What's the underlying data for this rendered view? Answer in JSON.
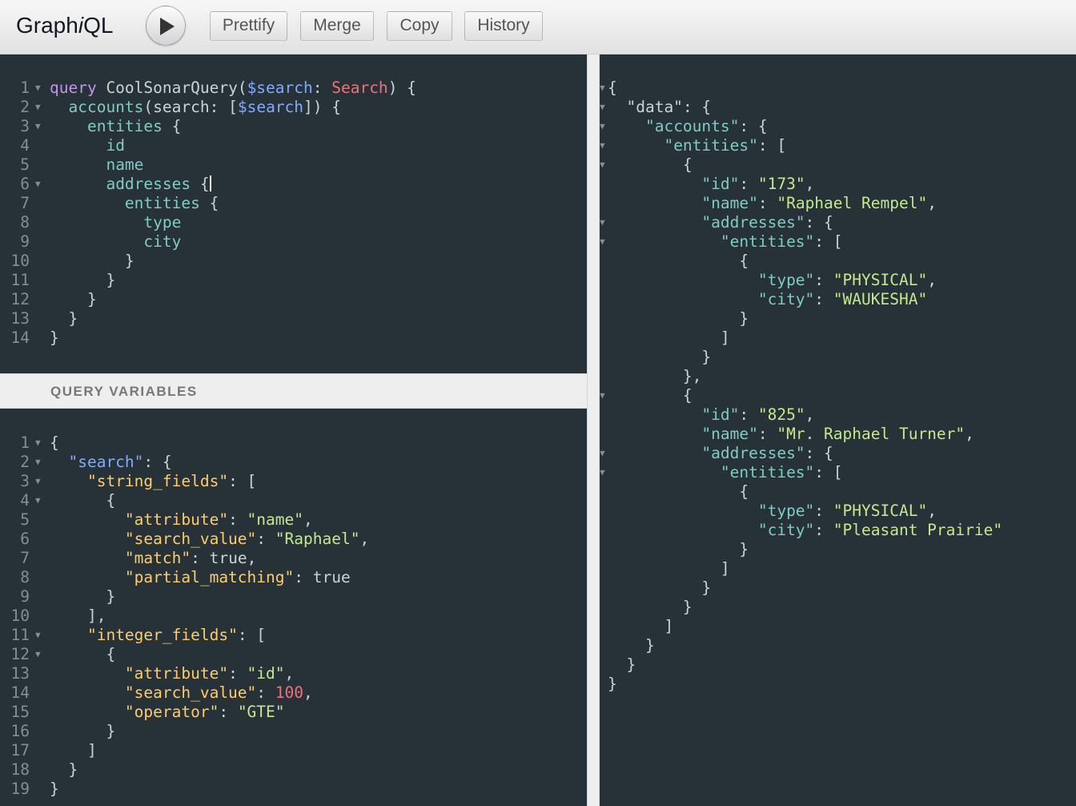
{
  "app": {
    "title_prefix": "Graph",
    "title_italic": "i",
    "title_suffix": "QL"
  },
  "toolbar": {
    "prettify": "Prettify",
    "merge": "Merge",
    "copy": "Copy",
    "history": "History"
  },
  "variables": {
    "header": "QUERY VARIABLES"
  },
  "query_editor": {
    "lines": [
      [
        [
          "kw",
          "query"
        ],
        [
          "def",
          " CoolSonarQuery"
        ],
        [
          "punc",
          "("
        ],
        [
          "var",
          "$search"
        ],
        [
          "punc",
          ": "
        ],
        [
          "type",
          "Search"
        ],
        [
          "punc",
          ") {"
        ]
      ],
      [
        [
          "def",
          "  "
        ],
        [
          "field",
          "accounts"
        ],
        [
          "punc",
          "("
        ],
        [
          "def",
          "search"
        ],
        [
          "punc",
          ": ["
        ],
        [
          "var",
          "$search"
        ],
        [
          "punc",
          "]) {"
        ]
      ],
      [
        [
          "def",
          "    "
        ],
        [
          "field",
          "entities"
        ],
        [
          "punc",
          " {"
        ]
      ],
      [
        [
          "def",
          "      "
        ],
        [
          "field",
          "id"
        ]
      ],
      [
        [
          "def",
          "      "
        ],
        [
          "field",
          "name"
        ]
      ],
      [
        [
          "def",
          "      "
        ],
        [
          "field",
          "addresses"
        ],
        [
          "punc",
          " {"
        ],
        [
          "cursor",
          ""
        ]
      ],
      [
        [
          "def",
          "        "
        ],
        [
          "field",
          "entities"
        ],
        [
          "punc",
          " {"
        ]
      ],
      [
        [
          "def",
          "          "
        ],
        [
          "field",
          "type"
        ]
      ],
      [
        [
          "def",
          "          "
        ],
        [
          "field",
          "city"
        ]
      ],
      [
        [
          "punc",
          "        }"
        ]
      ],
      [
        [
          "punc",
          "      }"
        ]
      ],
      [
        [
          "punc",
          "    }"
        ]
      ],
      [
        [
          "punc",
          "  }"
        ]
      ],
      [
        [
          "punc",
          "}"
        ]
      ]
    ],
    "folds": [
      1,
      2,
      3,
      6
    ]
  },
  "variables_editor": {
    "lines": [
      [
        [
          "punc",
          "{"
        ]
      ],
      [
        [
          "def",
          "  "
        ],
        [
          "vkey",
          "\"search\""
        ],
        [
          "punc",
          ": {"
        ]
      ],
      [
        [
          "def",
          "    "
        ],
        [
          "vkey2",
          "\"string_fields\""
        ],
        [
          "punc",
          ": ["
        ]
      ],
      [
        [
          "punc",
          "      {"
        ]
      ],
      [
        [
          "def",
          "        "
        ],
        [
          "vkey2",
          "\"attribute\""
        ],
        [
          "punc",
          ": "
        ],
        [
          "str",
          "\"name\""
        ],
        [
          "punc",
          ","
        ]
      ],
      [
        [
          "def",
          "        "
        ],
        [
          "vkey2",
          "\"search_value\""
        ],
        [
          "punc",
          ": "
        ],
        [
          "str",
          "\"Raphael\""
        ],
        [
          "punc",
          ","
        ]
      ],
      [
        [
          "def",
          "        "
        ],
        [
          "vkey2",
          "\"match\""
        ],
        [
          "punc",
          ": "
        ],
        [
          "bool",
          "true"
        ],
        [
          "punc",
          ","
        ]
      ],
      [
        [
          "def",
          "        "
        ],
        [
          "vkey2",
          "\"partial_matching\""
        ],
        [
          "punc",
          ": "
        ],
        [
          "bool",
          "true"
        ]
      ],
      [
        [
          "punc",
          "      }"
        ]
      ],
      [
        [
          "punc",
          "    ],"
        ]
      ],
      [
        [
          "def",
          "    "
        ],
        [
          "vkey2",
          "\"integer_fields\""
        ],
        [
          "punc",
          ": ["
        ]
      ],
      [
        [
          "punc",
          "      {"
        ]
      ],
      [
        [
          "def",
          "        "
        ],
        [
          "vkey2",
          "\"attribute\""
        ],
        [
          "punc",
          ": "
        ],
        [
          "str",
          "\"id\""
        ],
        [
          "punc",
          ","
        ]
      ],
      [
        [
          "def",
          "        "
        ],
        [
          "vkey2",
          "\"search_value\""
        ],
        [
          "punc",
          ": "
        ],
        [
          "num",
          "100"
        ],
        [
          "punc",
          ","
        ]
      ],
      [
        [
          "def",
          "        "
        ],
        [
          "vkey2",
          "\"operator\""
        ],
        [
          "punc",
          ": "
        ],
        [
          "str",
          "\"GTE\""
        ]
      ],
      [
        [
          "punc",
          "      }"
        ]
      ],
      [
        [
          "punc",
          "    ]"
        ]
      ],
      [
        [
          "punc",
          "  }"
        ]
      ],
      [
        [
          "punc",
          "}"
        ]
      ]
    ],
    "folds": [
      1,
      2,
      3,
      4,
      11,
      12
    ]
  },
  "result_viewer": {
    "lines": [
      [
        [
          "punc",
          "{"
        ]
      ],
      [
        [
          "def",
          "  "
        ],
        [
          "def",
          "\"data\""
        ],
        [
          "punc",
          ": {"
        ]
      ],
      [
        [
          "def",
          "    "
        ],
        [
          "rkey",
          "\"accounts\""
        ],
        [
          "punc",
          ": {"
        ]
      ],
      [
        [
          "def",
          "      "
        ],
        [
          "rkey",
          "\"entities\""
        ],
        [
          "punc",
          ": ["
        ]
      ],
      [
        [
          "punc",
          "        {"
        ]
      ],
      [
        [
          "def",
          "          "
        ],
        [
          "rkey",
          "\"id\""
        ],
        [
          "punc",
          ": "
        ],
        [
          "rstr",
          "\"173\""
        ],
        [
          "punc",
          ","
        ]
      ],
      [
        [
          "def",
          "          "
        ],
        [
          "rkey",
          "\"name\""
        ],
        [
          "punc",
          ": "
        ],
        [
          "rstr",
          "\"Raphael Rempel\""
        ],
        [
          "punc",
          ","
        ]
      ],
      [
        [
          "def",
          "          "
        ],
        [
          "rkey",
          "\"addresses\""
        ],
        [
          "punc",
          ": {"
        ]
      ],
      [
        [
          "def",
          "            "
        ],
        [
          "rkey",
          "\"entities\""
        ],
        [
          "punc",
          ": ["
        ]
      ],
      [
        [
          "punc",
          "              {"
        ]
      ],
      [
        [
          "def",
          "                "
        ],
        [
          "rkey",
          "\"type\""
        ],
        [
          "punc",
          ": "
        ],
        [
          "rstr",
          "\"PHYSICAL\""
        ],
        [
          "punc",
          ","
        ]
      ],
      [
        [
          "def",
          "                "
        ],
        [
          "rkey",
          "\"city\""
        ],
        [
          "punc",
          ": "
        ],
        [
          "rstr",
          "\"WAUKESHA\""
        ]
      ],
      [
        [
          "punc",
          "              }"
        ]
      ],
      [
        [
          "punc",
          "            ]"
        ]
      ],
      [
        [
          "punc",
          "          }"
        ]
      ],
      [
        [
          "punc",
          "        },"
        ]
      ],
      [
        [
          "punc",
          "        {"
        ]
      ],
      [
        [
          "def",
          "          "
        ],
        [
          "rkey",
          "\"id\""
        ],
        [
          "punc",
          ": "
        ],
        [
          "rstr",
          "\"825\""
        ],
        [
          "punc",
          ","
        ]
      ],
      [
        [
          "def",
          "          "
        ],
        [
          "rkey",
          "\"name\""
        ],
        [
          "punc",
          ": "
        ],
        [
          "rstr",
          "\"Mr. Raphael Turner\""
        ],
        [
          "punc",
          ","
        ]
      ],
      [
        [
          "def",
          "          "
        ],
        [
          "rkey",
          "\"addresses\""
        ],
        [
          "punc",
          ": {"
        ]
      ],
      [
        [
          "def",
          "            "
        ],
        [
          "rkey",
          "\"entities\""
        ],
        [
          "punc",
          ": ["
        ]
      ],
      [
        [
          "punc",
          "              {"
        ]
      ],
      [
        [
          "def",
          "                "
        ],
        [
          "rkey",
          "\"type\""
        ],
        [
          "punc",
          ": "
        ],
        [
          "rstr",
          "\"PHYSICAL\""
        ],
        [
          "punc",
          ","
        ]
      ],
      [
        [
          "def",
          "                "
        ],
        [
          "rkey",
          "\"city\""
        ],
        [
          "punc",
          ": "
        ],
        [
          "rstr",
          "\"Pleasant Prairie\""
        ]
      ],
      [
        [
          "punc",
          "              }"
        ]
      ],
      [
        [
          "punc",
          "            ]"
        ]
      ],
      [
        [
          "punc",
          "          }"
        ]
      ],
      [
        [
          "punc",
          "        }"
        ]
      ],
      [
        [
          "punc",
          "      ]"
        ]
      ],
      [
        [
          "punc",
          "    }"
        ]
      ],
      [
        [
          "punc",
          "  }"
        ]
      ],
      [
        [
          "punc",
          "}"
        ]
      ]
    ],
    "folds": [
      1,
      2,
      3,
      4,
      5,
      8,
      9,
      17,
      20,
      21
    ]
  }
}
